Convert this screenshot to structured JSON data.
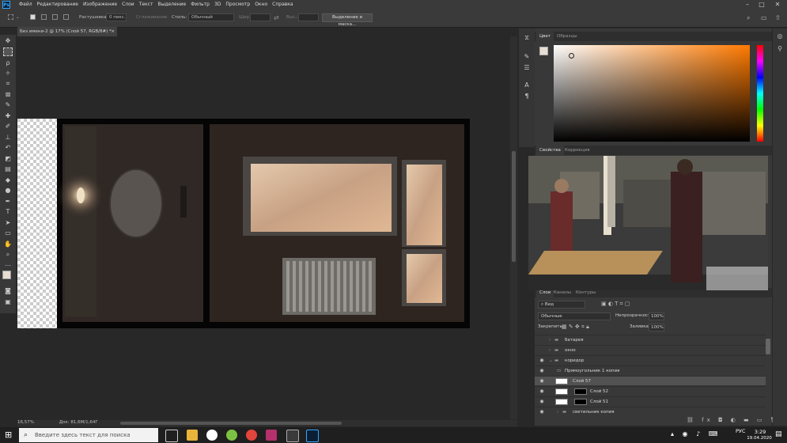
{
  "menubar": {
    "app_logo": "Ps",
    "items": [
      "Файл",
      "Редактирование",
      "Изображение",
      "Слои",
      "Текст",
      "Выделение",
      "Фильтр",
      "3D",
      "Просмотр",
      "Окно",
      "Справка"
    ],
    "window_controls": [
      "–",
      "□",
      "✕"
    ]
  },
  "options": {
    "feather_label": "Растушевка:",
    "feather_value": "0 пикс.",
    "antialias_label": "Сглаживание",
    "style_label": "Стиль:",
    "style_value": "Обычный",
    "width_label": "Шир.:",
    "height_label": "Выс.:",
    "select_mask_button": "Выделение и маска..."
  },
  "document": {
    "tab_title": "Без имени-2 @ 17% (Слой 57, RGB/8#) *",
    "close": "×"
  },
  "status": {
    "zoom": "16,57%",
    "doc_info": "Док: 81,6M/1,64Г"
  },
  "color_panel": {
    "tabs": [
      "Цвет",
      "Образцы"
    ]
  },
  "properties_panel": {
    "tabs": [
      "Свойства",
      "Коррекция"
    ]
  },
  "layers_panel": {
    "tabs": [
      "Слои",
      "Каналы",
      "Контуры"
    ],
    "filter_label": "Вид",
    "blend_mode": "Обычные",
    "opacity_label": "Непрозрачность:",
    "opacity_value": "100%",
    "lock_label": "Закрепить:",
    "fill_label": "Заливка:",
    "fill_value": "100%",
    "layers": [
      {
        "name": "батарея",
        "visible": false,
        "type": "group"
      },
      {
        "name": "окно",
        "visible": false,
        "type": "group"
      },
      {
        "name": "коридор",
        "visible": true,
        "type": "group"
      },
      {
        "name": "Прямоугольник 1 копия",
        "visible": true,
        "type": "shape"
      },
      {
        "name": "Слой 57",
        "visible": true,
        "type": "layer",
        "selected": true
      },
      {
        "name": "Слой 52",
        "visible": true,
        "type": "masked"
      },
      {
        "name": "Слой 51",
        "visible": true,
        "type": "masked"
      },
      {
        "name": "светильник копия",
        "visible": true,
        "type": "group"
      }
    ]
  },
  "taskbar": {
    "search_placeholder": "Введите здесь текст для поиска",
    "language": "РУС",
    "time": "3:29",
    "date": "19.04.2020"
  },
  "colors": {
    "accent": "#31a8ff",
    "panel_bg": "#383838",
    "canvas_bg": "#282828"
  }
}
